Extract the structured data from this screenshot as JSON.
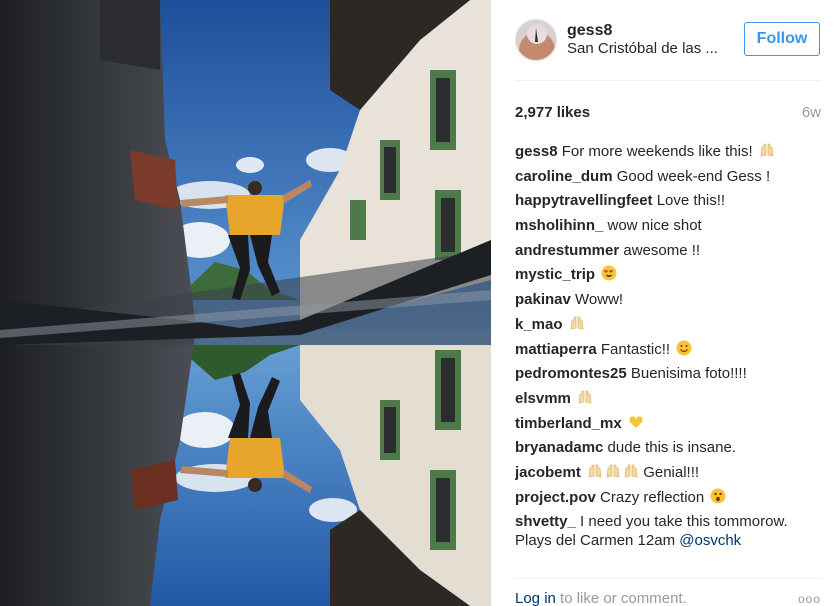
{
  "post": {
    "username": "gess8",
    "location": "San Cristóbal de las ...",
    "follow_label": "Follow",
    "likes": "2,977 likes",
    "age": "6w"
  },
  "comments": [
    {
      "user": "gess8",
      "text": "For more weekends like this!",
      "emoji": "raised-hands"
    },
    {
      "user": "caroline_dum",
      "text": "Good week-end Gess !"
    },
    {
      "user": "happytravellingfeet",
      "text": "Love this!!"
    },
    {
      "user": "msholihinn_",
      "text": "wow nice shot"
    },
    {
      "user": "andrestummer",
      "text": "awesome !!"
    },
    {
      "user": "mystic_trip",
      "text": "",
      "emoji": "heart-eyes"
    },
    {
      "user": "pakinav",
      "text": "Woww!"
    },
    {
      "user": "k_mao",
      "text": "",
      "emoji": "raised-hands"
    },
    {
      "user": "mattiaperra",
      "text": "Fantastic!!",
      "emoji": "smiley"
    },
    {
      "user": "pedromontes25",
      "text": "Buenisima foto!!!!"
    },
    {
      "user": "elsvmm",
      "text": "",
      "emoji": "raised-hands"
    },
    {
      "user": "timberland_mx",
      "text": "",
      "emoji": "yellow-heart"
    },
    {
      "user": "bryanadamc",
      "text": "dude this is insane."
    },
    {
      "user": "jacobemt",
      "text": "Genial!!!",
      "emoji_before": "raised-hands-x3"
    },
    {
      "user": "project.pov",
      "text": "Crazy reflection",
      "emoji": "astonished"
    },
    {
      "user": "shvetty_",
      "text": "I need you take this tommorow. Plays del Carmen 12am",
      "mention": "@osvchk"
    }
  ],
  "footer": {
    "login_link": "Log in",
    "login_text": "to like or comment.",
    "more_label": "ooo"
  },
  "colors": {
    "follow_blue": "#3897f0",
    "link_navy": "#003569",
    "muted_gray": "#999999",
    "text_dark": "#262626"
  }
}
